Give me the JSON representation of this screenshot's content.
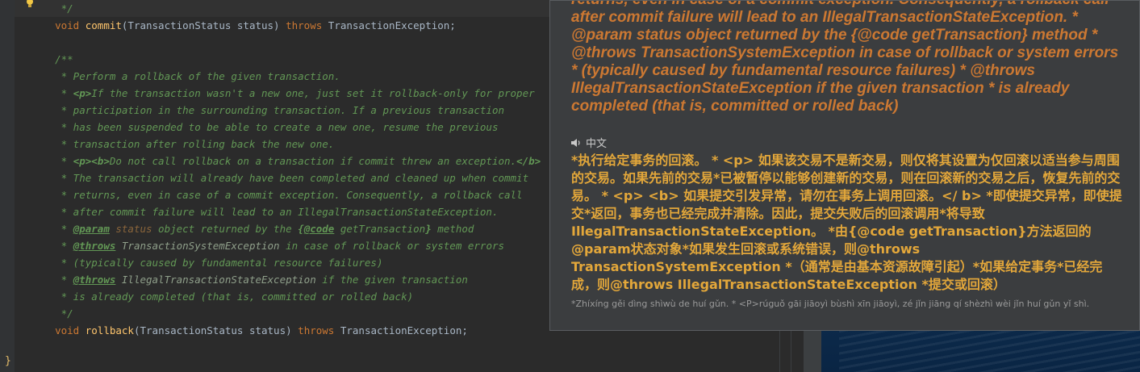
{
  "editor": {
    "lines": [
      {
        "text": "     */"
      },
      {
        "prefix": "    ",
        "kw1": "void",
        "fname": "commit",
        "args": "(TransactionStatus status) ",
        "kw2": "throws",
        "rest": " TransactionException;"
      },
      {
        "text": ""
      },
      {
        "text": "    /**"
      },
      {
        "text": "     * Perform a rollback of the given transaction."
      },
      {
        "pre": "     * ",
        "tag": "<p>",
        "post": "If the transaction wasn't a new one, just set it rollback-only for proper"
      },
      {
        "text": "     * participation in the surrounding transaction. If a previous transaction"
      },
      {
        "text": "     * has been suspended to be able to create a new one, resume the previous"
      },
      {
        "text": "     * transaction after rolling back the new one."
      },
      {
        "pre": "     * ",
        "tag": "<p><b>",
        "post": "Do not call rollback on a transaction if commit threw an exception.",
        "tag2": "</b>"
      },
      {
        "text": "     * The transaction will already have been completed and cleaned up when commit"
      },
      {
        "text": "     * returns, even in case of a commit exception. Consequently, a rollback call"
      },
      {
        "text": "     * after commit failure will lead to an IllegalTransactionStateException."
      },
      {
        "pre": "     * ",
        "ptag": "@param",
        "pname": " status",
        "mid": " object returned by the ",
        "code1": "{",
        "codetag": "@code",
        "code2": " getTransaction",
        "code3": "}",
        "post": " method"
      },
      {
        "pre": "     * ",
        "ptag": "@throws",
        "pname": " TransactionSystemException",
        "post": " in case of rollback or system errors"
      },
      {
        "text": "     * (typically caused by fundamental resource failures)"
      },
      {
        "pre": "     * ",
        "ptag": "@throws",
        "pname": " IllegalTransactionStateException",
        "post": " if the given transaction"
      },
      {
        "text": "     * is already completed (that is, committed or rolled back)"
      },
      {
        "text": "     */"
      },
      {
        "prefix": "    ",
        "kw1": "void",
        "fname": "rollback",
        "args": "(TransactionStatus status) ",
        "kw2": "throws",
        "rest": " TransactionException;"
      }
    ],
    "closing_brace": "}"
  },
  "popup": {
    "source_text": "returns, even in case of a commit exception. Consequently, a rollback call * after commit failure will lead to an IllegalTransactionStateException. * @param status object returned by the {@code getTransaction} method * @throws TransactionSystemException in case of rollback or system errors * (typically caused by fundamental resource failures) * @throws IllegalTransactionStateException if the given transaction * is already completed (that is, committed or rolled back)",
    "language_label": "中文",
    "translation": "*执行给定事务的回滚。 * <p> 如果该交易不是新交易，则仅将其设置为仅回滚以适当参与周围的交易。如果先前的交易*已被暂停以能够创建新的交易，则在回滚新的交易之后，恢复先前的交易。 * <p> <b> 如果提交引发异常，请勿在事务上调用回滚。</ b> *即使提交异常，即使提交*返回，事务也已经完成并清除。因此，提交失败后的回滚调用*将导致IllegalTransactionStateException。 *由{@code getTransaction}方法返回的@param状态对象*如果发生回滚或系统错误，则@throws TransactionSystemException *（通常是由基本资源故障引起）*如果给定事务*已经完成，则@throws IllegalTransactionStateException *提交或回滚）",
    "pinyin": "*Zhíxíng gěi dìng shìwù de huí gǔn. * <P>rúguǒ gāi jiāoyì bùshì xīn jiāoyì, zé jǐn jiāng qí shèzhì wèi jǐn huí gǔn yǐ shì."
  },
  "colors": {
    "keyword": "#cc7832",
    "comment": "#629755",
    "method": "#ffc66d",
    "popup_source": "#cc7832",
    "popup_translation": "#e3a73a"
  }
}
